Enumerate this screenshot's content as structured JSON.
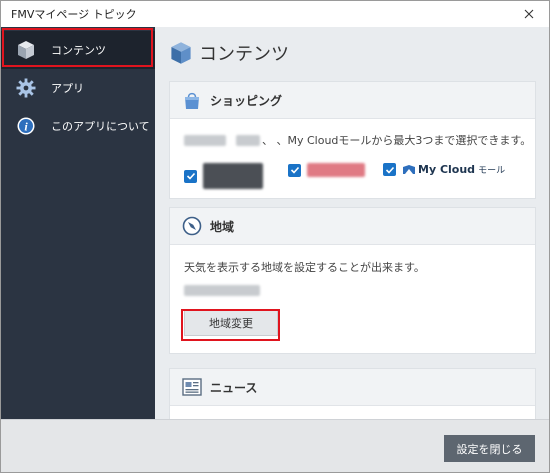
{
  "window": {
    "title": "FMVマイページ トピック",
    "close_label": "✕"
  },
  "sidebar": {
    "items": [
      {
        "label": "コンテンツ",
        "icon": "cube-icon"
      },
      {
        "label": "アプリ",
        "icon": "gear-icon"
      },
      {
        "label": "このアプリについて",
        "icon": "info-icon"
      }
    ]
  },
  "main": {
    "title": "コンテンツ",
    "shopping": {
      "title": "ショッピング",
      "description": "、 、My Cloudモールから最大3つまで選択できます。",
      "options": [
        {
          "label": "",
          "checked": true
        },
        {
          "label": "",
          "checked": true
        },
        {
          "label": "My Cloud",
          "sub": "モール",
          "checked": true
        }
      ]
    },
    "region": {
      "title": "地域",
      "description": "天気を表示する地域を設定することが出来ます。",
      "change_button": "地域変更"
    },
    "news": {
      "title": "ニュース"
    }
  },
  "footer": {
    "close_settings_button": "設定を閉じる"
  },
  "colors": {
    "sidebar_bg": "#2b3442",
    "sidebar_active": "#1d232d",
    "accent_blue": "#1a73c7",
    "highlight_red": "#e0141e",
    "footer_button": "#5d6670"
  }
}
